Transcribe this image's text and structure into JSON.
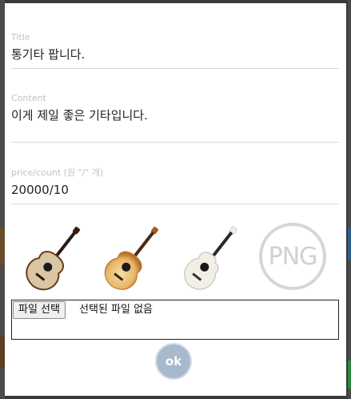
{
  "form": {
    "title_label": "Title",
    "title_value": "통기타 팝니다.",
    "content_label": "Content",
    "content_value": "이게 제일 좋은 기타입니다.",
    "price_label": "price/count (원 \"/\" 개)",
    "price_value": "20000/10"
  },
  "images": {
    "items": [
      {
        "name": "guitar-dark-natural"
      },
      {
        "name": "guitar-sunburst-light"
      },
      {
        "name": "guitar-white"
      }
    ],
    "placeholder_text": "PNG"
  },
  "file_input": {
    "button_label": "파일 선택",
    "status_text": "선택된 파일 없음"
  },
  "submit": {
    "label": "ok"
  },
  "colors": {
    "accent": "#a7b9cd",
    "label": "#c2c2c2",
    "divider": "#d9d9d9"
  }
}
